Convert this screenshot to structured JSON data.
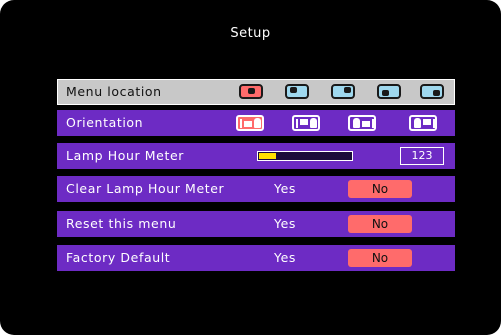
{
  "title": "Setup",
  "rows": [
    {
      "label": "Menu location"
    },
    {
      "label": "Orientation"
    },
    {
      "label": "Lamp Hour Meter",
      "value": "123",
      "meter_fraction": 0.18
    },
    {
      "label": "Clear Lamp Hour Meter",
      "yes": "Yes",
      "no": "No"
    },
    {
      "label": "Reset this menu",
      "yes": "Yes",
      "no": "No"
    },
    {
      "label": "Factory Default",
      "yes": "Yes",
      "no": "No"
    }
  ],
  "menu_location_options": [
    {
      "icon": "menu-position-center-icon",
      "selected": true
    },
    {
      "icon": "menu-position-top-left-icon",
      "selected": false
    },
    {
      "icon": "menu-position-top-right-icon",
      "selected": false
    },
    {
      "icon": "menu-position-bottom-left-icon",
      "selected": false
    },
    {
      "icon": "menu-position-bottom-right-icon",
      "selected": false
    }
  ],
  "orientation_options": [
    {
      "icon": "front-desktop-icon",
      "selected": true
    },
    {
      "icon": "rear-desktop-icon",
      "selected": false
    },
    {
      "icon": "front-ceiling-icon",
      "selected": false
    },
    {
      "icon": "rear-ceiling-icon",
      "selected": false
    }
  ],
  "colors": {
    "background": "#000000",
    "row": "#6d2bc4",
    "selected_row": "#c8c8c8",
    "accent": "#ff6b6b",
    "icon_fill": "#9fd8ee",
    "meter_fill": "#ffe000"
  }
}
